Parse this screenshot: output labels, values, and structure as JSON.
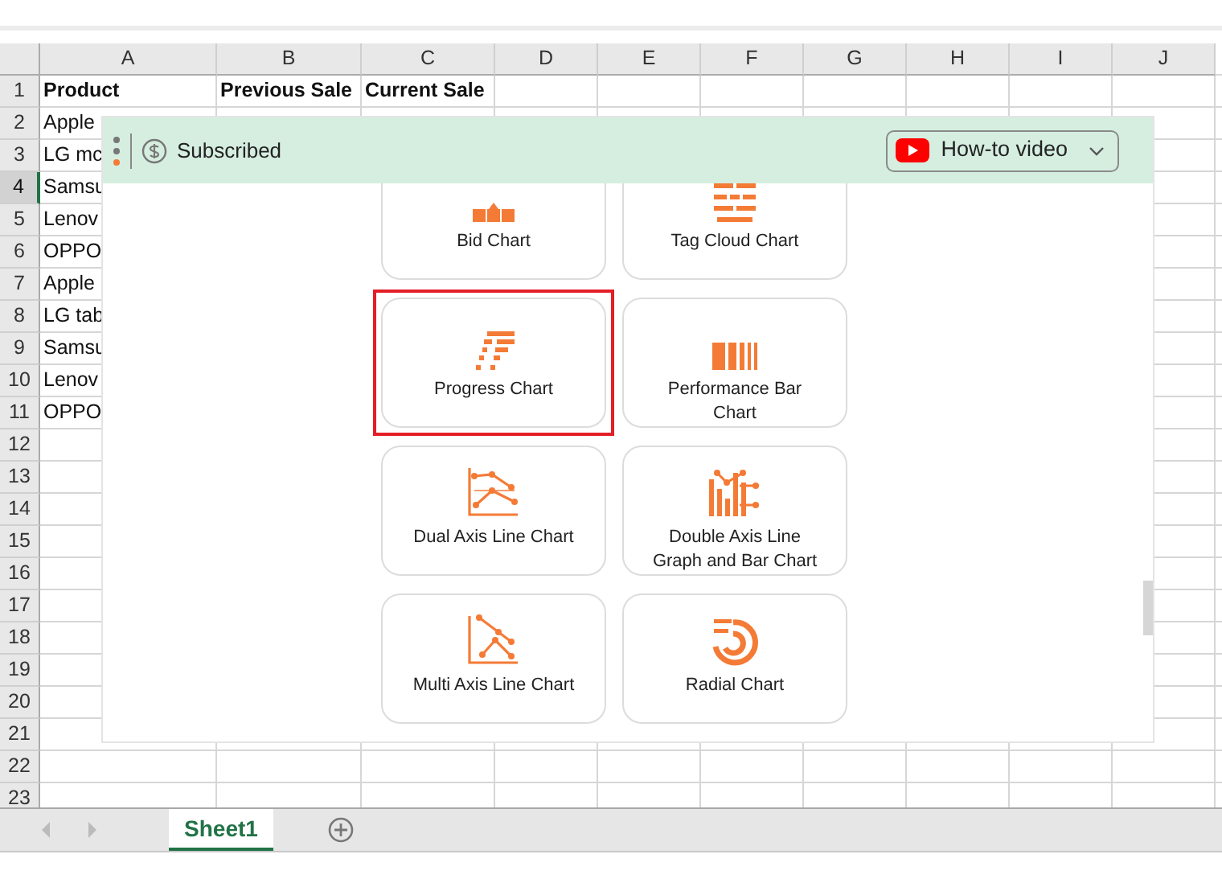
{
  "columns": [
    "A",
    "B",
    "C",
    "D",
    "E",
    "F",
    "G",
    "H",
    "I",
    "J"
  ],
  "rows": [
    {
      "number": "1",
      "selected": false,
      "cells": [
        "Product",
        "Previous Sale",
        "Current Sale"
      ]
    },
    {
      "number": "2",
      "selected": false,
      "cells": [
        "Apple"
      ]
    },
    {
      "number": "3",
      "selected": false,
      "cells": [
        "LG mc"
      ]
    },
    {
      "number": "4",
      "selected": true,
      "cells": [
        "Samsu"
      ]
    },
    {
      "number": "5",
      "selected": false,
      "cells": [
        "Lenov"
      ]
    },
    {
      "number": "6",
      "selected": false,
      "cells": [
        "OPPO"
      ]
    },
    {
      "number": "7",
      "selected": false,
      "cells": [
        "Apple"
      ]
    },
    {
      "number": "8",
      "selected": false,
      "cells": [
        "LG tab"
      ]
    },
    {
      "number": "9",
      "selected": false,
      "cells": [
        "Samsu"
      ]
    },
    {
      "number": "10",
      "selected": false,
      "cells": [
        "Lenov"
      ]
    },
    {
      "number": "11",
      "selected": false,
      "cells": [
        "OPPO"
      ]
    },
    {
      "number": "12",
      "selected": false
    },
    {
      "number": "13",
      "selected": false
    },
    {
      "number": "14",
      "selected": false
    },
    {
      "number": "15",
      "selected": false
    },
    {
      "number": "16",
      "selected": false
    },
    {
      "number": "17",
      "selected": false
    },
    {
      "number": "18",
      "selected": false
    },
    {
      "number": "19",
      "selected": false
    },
    {
      "number": "20",
      "selected": false
    },
    {
      "number": "21",
      "selected": false
    },
    {
      "number": "22",
      "selected": false
    },
    {
      "number": "23",
      "selected": false
    }
  ],
  "panel": {
    "status": "Subscribed",
    "video_button": "How-to video",
    "cards": [
      {
        "label": "Bid Chart",
        "kind": "bid",
        "selected": false
      },
      {
        "label": "Tag Cloud Chart",
        "kind": "tagcloud",
        "selected": false
      },
      {
        "label": "Progress Chart",
        "kind": "progress",
        "selected": true
      },
      {
        "label": "Performance Bar Chart",
        "kind": "performance",
        "selected": false
      },
      {
        "label": "Dual Axis Line Chart",
        "kind": "dualaxis",
        "selected": false
      },
      {
        "label": "Double Axis Line Graph and Bar Chart",
        "kind": "doubleaxis",
        "selected": false
      },
      {
        "label": "Multi Axis Line Chart",
        "kind": "multiaxis",
        "selected": false
      },
      {
        "label": "Radial Chart",
        "kind": "radial",
        "selected": false
      }
    ]
  },
  "sheet_tabs": [
    {
      "label": "Sheet1",
      "selected": true
    }
  ]
}
